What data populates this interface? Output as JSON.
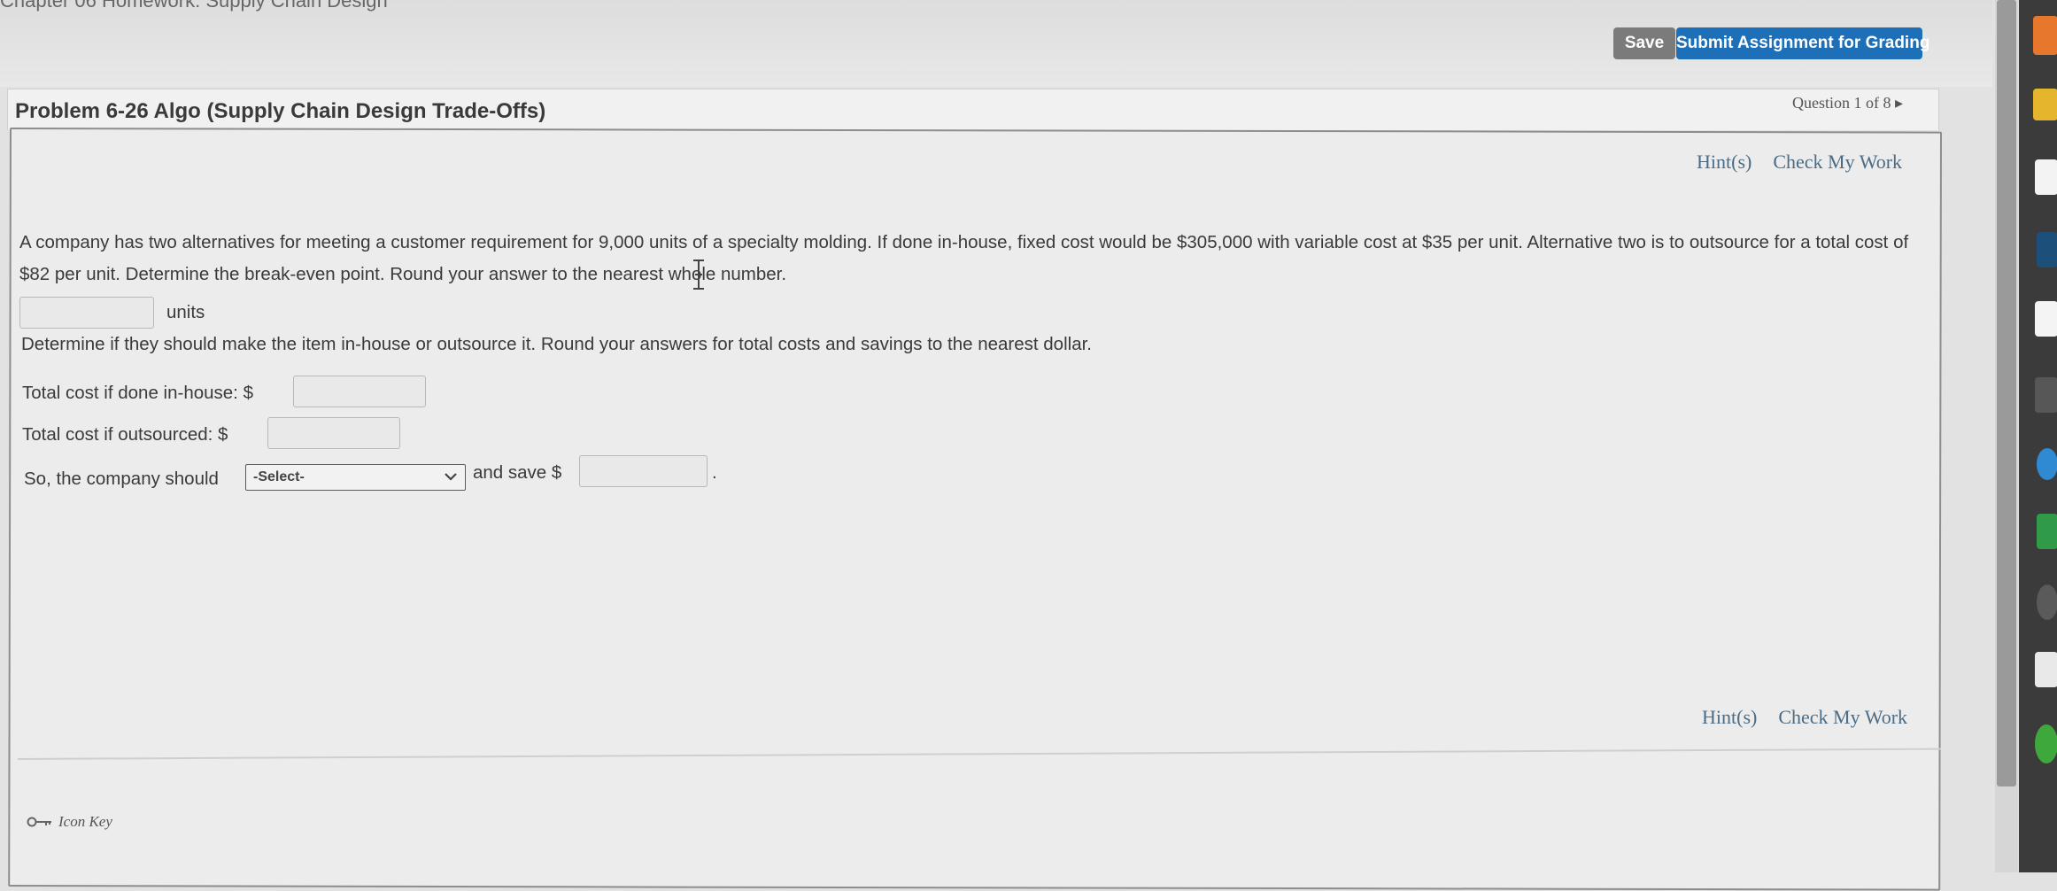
{
  "header": {
    "cut_title": "Chapter 06 Homework: Supply Chain Design",
    "save_label": "Save",
    "submit_label": "Submit Assignment for Grading"
  },
  "problem": {
    "title": "Problem 6-26 Algo (Supply Chain Design Trade-Offs)",
    "question_nav": "Question 1 of 8 ▸"
  },
  "hints": {
    "hint_label": "Hint(s)",
    "check_label": "Check My Work"
  },
  "question": {
    "text": "A company has two alternatives for meeting a customer requirement for 9,000 units of a specialty molding. If done in-house, fixed cost would be $305,000 with variable cost at $35 per unit. Alternative two is to outsource for a total cost of $82 per unit. Determine the break-even point. Round your answer to the nearest whole number.",
    "units_label": "units",
    "instruction": "Determine if they should make the item in-house or outsource it. Round your answers for total costs and savings to the nearest dollar.",
    "inhouse_label": "Total cost if done in-house: $",
    "outsource_label": "Total cost if outsourced: $",
    "so_label": "So, the company should",
    "select_value": "-Select-",
    "save_label": "and save $",
    "period": "."
  },
  "footer": {
    "icon_key_label": "Icon Key"
  },
  "colors": {
    "submit_blue": "#1d6fb8",
    "save_gray": "#7b7b7b",
    "hint_link": "#4a6c86"
  }
}
